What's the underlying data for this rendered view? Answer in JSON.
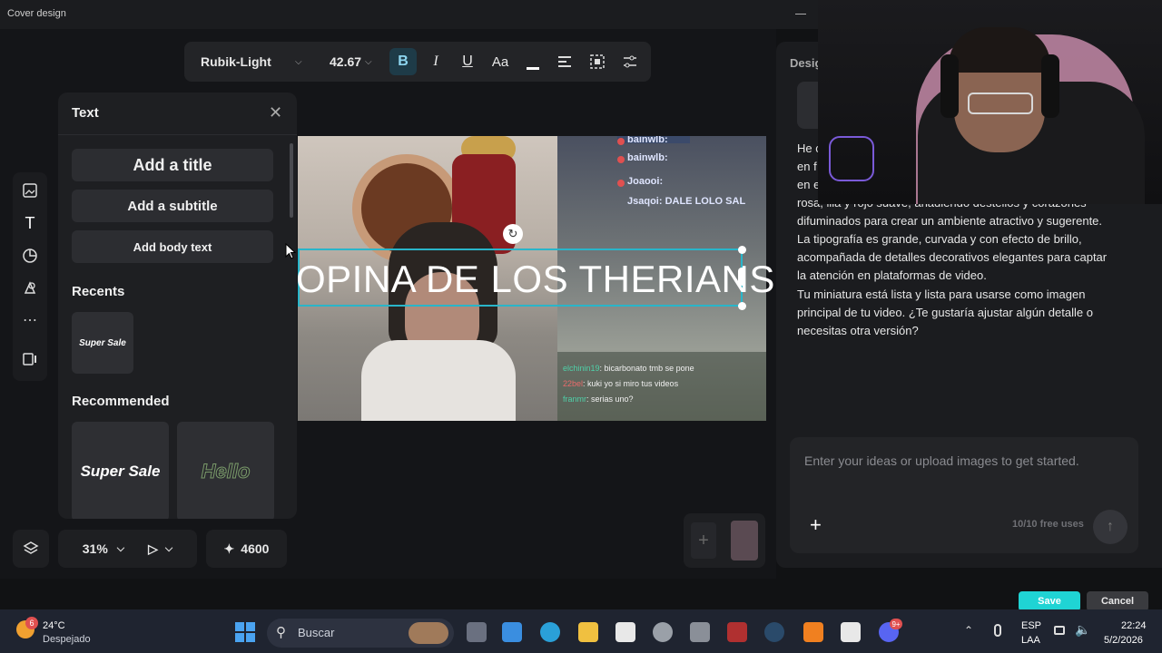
{
  "window": {
    "title": "Cover design"
  },
  "toolbar": {
    "font": "Rubik-Light",
    "size": "42.67",
    "bold": "B",
    "italic": "I",
    "underline": "U",
    "case": "Aa"
  },
  "text_panel": {
    "title": "Text",
    "add_title": "Add a title",
    "add_subtitle": "Add a subtitle",
    "add_body": "Add body text",
    "recents_label": "Recents",
    "recent_item": "Super Sale",
    "recommended_label": "Recommended",
    "rec_items": [
      "Super Sale",
      "Hello"
    ]
  },
  "canvas": {
    "overlay_text": "OPINA DE LOS THERIANS",
    "chat_top": [
      "bainwlb:",
      "bainwlb:",
      "Joaooi:",
      "Jsaqoi: DALE LOLO SAL"
    ],
    "chat_bottom": [
      {
        "user": "elchinin19",
        "msg": ": bicarbonato tmb se pone"
      },
      {
        "user": "22bel",
        "msg": ": kuki yo si miro tus videos"
      },
      {
        "user": "franmr",
        "msg": ": serias uno?"
      }
    ]
  },
  "bottom_bar": {
    "zoom": "31%",
    "credits": "4600"
  },
  "design_panel": {
    "tab": "Desig",
    "paragraph1_lines": [
      "He c",
      "en f",
      "en e",
      "rosa, lila y rojo suave, añadiendo destellos y corazones",
      "difuminados para crear un ambiente atractivo y sugerente.",
      "La tipografía es grande, curvada y con efecto de brillo,",
      "acompañada de detalles decorativos elegantes para captar",
      "la atención en plataformas de video."
    ],
    "paragraph2_lines": [
      "Tu miniatura está lista y lista para usarse como imagen",
      "principal de tu video. ¿Te gustaría ajustar algún detalle o",
      "necesitas otra versión?"
    ],
    "input_placeholder": "Enter your ideas or upload images to get started.",
    "free_uses": "10/10 free uses"
  },
  "actions": {
    "save": "Save",
    "cancel": "Cancel"
  },
  "taskbar": {
    "weather_temp": "24°C",
    "weather_desc": "Despejado",
    "weather_badge": "6",
    "search": "Buscar",
    "lang1": "ESP",
    "lang2": "LAA",
    "time": "22:24",
    "date": "5/2/2026",
    "discord_badge": "9+"
  },
  "colors": {
    "accent": "#1fd4d4",
    "selection": "#29b5c9"
  }
}
